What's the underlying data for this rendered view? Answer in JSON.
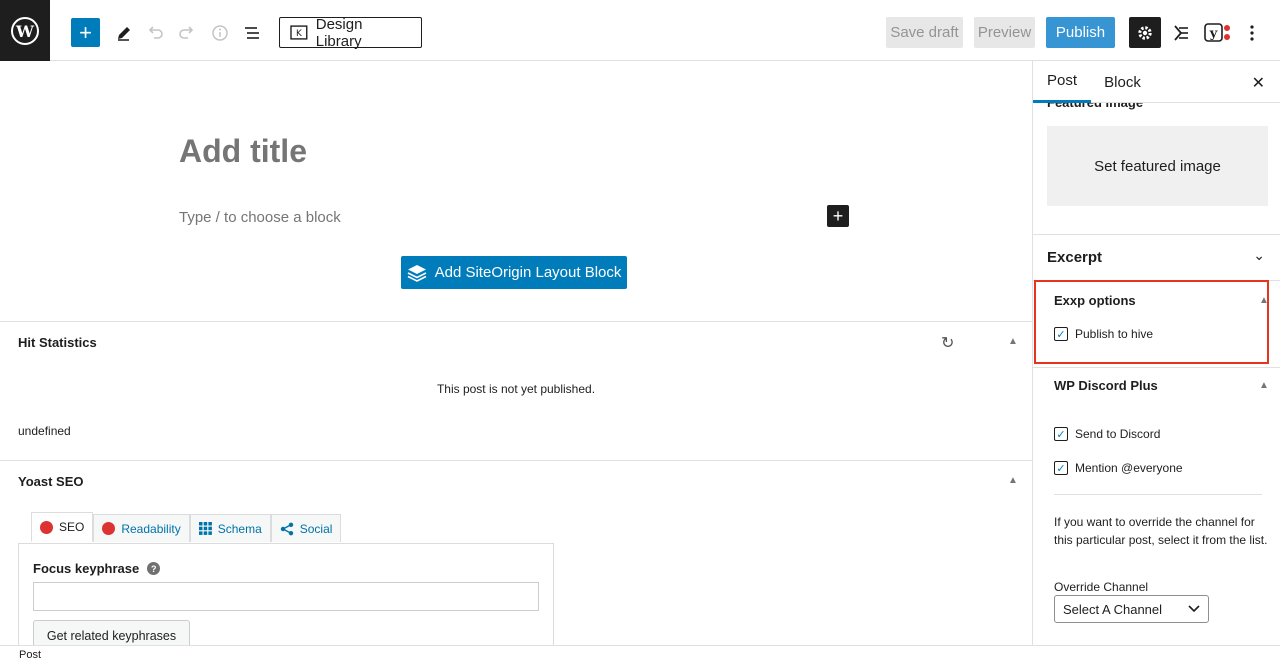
{
  "toolbar": {
    "design_library": "Design Library",
    "save_draft": "Save draft",
    "preview": "Preview",
    "publish": "Publish"
  },
  "editor": {
    "title_placeholder": "Add title",
    "block_placeholder": "Type / to choose a block",
    "siteorigin_button": "Add SiteOrigin Layout Block"
  },
  "hit_statistics": {
    "title": "Hit Statistics",
    "message": "This post is not yet published.",
    "extra": "undefined"
  },
  "yoast": {
    "title": "Yoast SEO",
    "tabs": [
      "SEO",
      "Readability",
      "Schema",
      "Social"
    ],
    "focus_label": "Focus keyphrase",
    "related_button": "Get related keyphrases"
  },
  "footer": {
    "breadcrumb": "Post"
  },
  "sidebar": {
    "tabs": [
      "Post",
      "Block"
    ],
    "featured_header": "Featured image",
    "featured_button": "Set featured image",
    "excerpt": "Excerpt",
    "exxp": {
      "title": "Exxp options",
      "publish_hive": "Publish to hive"
    },
    "discord": {
      "title": "WP Discord Plus",
      "send": "Send to Discord",
      "mention": "Mention @everyone",
      "override_text": "If you want to override the channel for this particular post, select it from the list.",
      "override_label": "Override Channel",
      "select_value": "Select A Channel"
    }
  },
  "colors": {
    "accent": "#007cba",
    "highlight": "#e3361c",
    "seo_dot": "#dc3232"
  }
}
